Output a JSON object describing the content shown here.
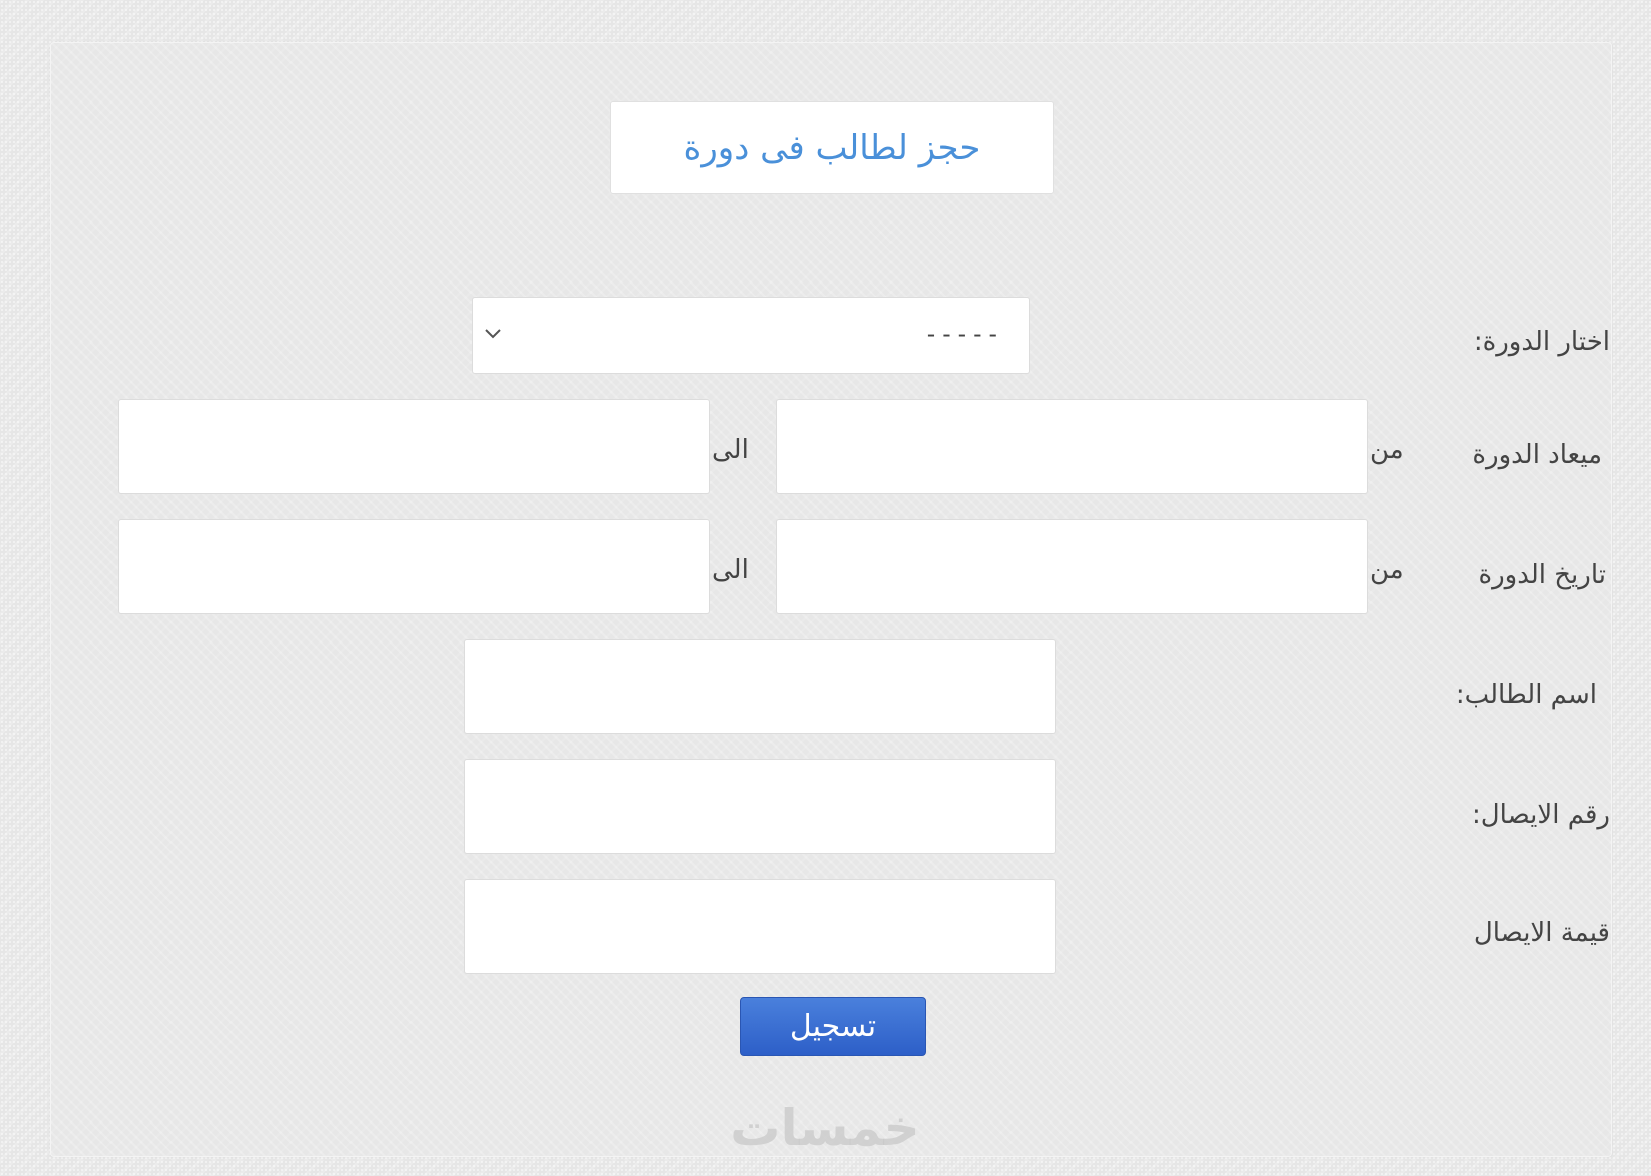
{
  "form": {
    "title": "حجز لطالب فى دورة",
    "course_select": {
      "label": "اختار الدورة:",
      "selected": "-----"
    },
    "schedule": {
      "label": "ميعاد الدورة",
      "from_label": "من",
      "to_label": "الى",
      "from_value": "",
      "to_value": ""
    },
    "dates": {
      "label": "تاريخ الدورة",
      "from_label": "من",
      "to_label": "الى",
      "from_value": "",
      "to_value": ""
    },
    "student_name": {
      "label": "اسم الطالب:",
      "value": ""
    },
    "receipt_number": {
      "label": "رقم الايصال:",
      "value": ""
    },
    "receipt_value": {
      "label": "قيمة الايصال",
      "value": ""
    },
    "submit_label": "تسجيل"
  },
  "watermark": "خمسات",
  "colors": {
    "title": "#4a90d9",
    "button": "#3a6fd4",
    "background": "#e6e6e6"
  },
  "icons": {
    "select_arrow": "chevron-down-icon"
  }
}
